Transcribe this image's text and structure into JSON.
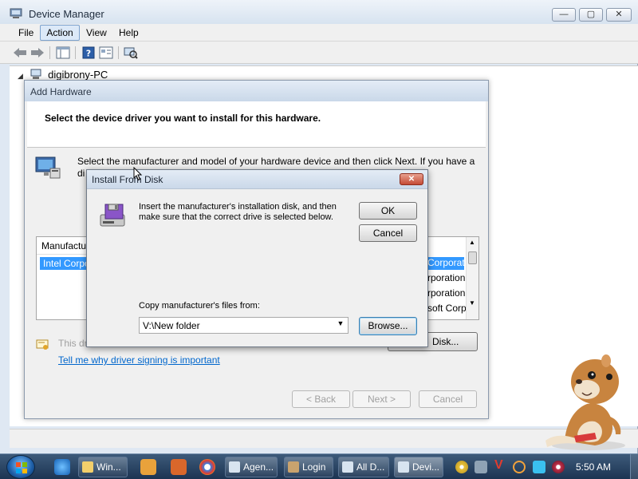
{
  "device_manager": {
    "title": "Device Manager",
    "caption_buttons": {
      "minimize": "—",
      "maximize": "▢",
      "close": "✕"
    },
    "menu": [
      "File",
      "Action",
      "View",
      "Help"
    ],
    "tree_root": "digibrony-PC"
  },
  "wizard": {
    "title": "Add Hardware",
    "header": "Select the device driver you want to install for this hardware.",
    "instruction": "Select the manufacturer and model of your hardware device and then click Next. If you have a",
    "instruction_cont": "di",
    "manufacturer_header": "Manufactu",
    "manufacturer_selected": "Intel Corpo",
    "model_rows": [
      "Corporati",
      "rporation",
      "rporation",
      "soft Corp"
    ],
    "signed_text": "This dr",
    "have_disk_label": "Disk...",
    "sign_link": "Tell me why driver signing is important",
    "buttons": {
      "back": "< Back",
      "next": "Next >",
      "cancel": "Cancel"
    }
  },
  "install_from_disk": {
    "title": "Install From Disk",
    "message": "Insert the manufacturer's installation disk, and then make sure that the correct drive is selected below.",
    "ok": "OK",
    "cancel": "Cancel",
    "copy_label": "Copy manufacturer's files from:",
    "path": "V:\\New folder",
    "browse": "Browse...",
    "close_glyph": "✕"
  },
  "taskbar": {
    "tasks": [
      {
        "label": "Win..."
      },
      {
        "label": "Agen..."
      },
      {
        "label": "Login"
      },
      {
        "label": "All D..."
      },
      {
        "label": "Devi..."
      }
    ],
    "clock": "5:50 AM",
    "tray_v": "V"
  },
  "colors": {
    "selection": "#3399ff",
    "link": "#0066cc",
    "close_red": "#c44a34"
  }
}
